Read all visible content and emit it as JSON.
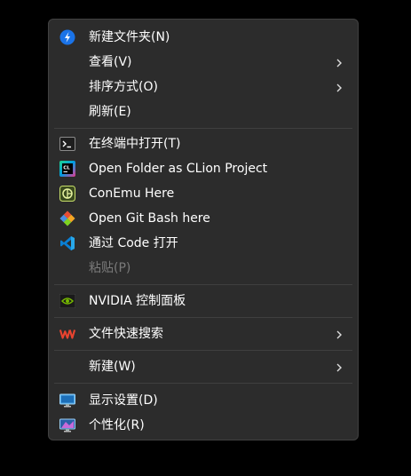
{
  "menu": {
    "items": [
      {
        "label": "新建文件夹(N)",
        "icon": "new-folder-icon"
      },
      {
        "label": "查看(V)",
        "submenu": true
      },
      {
        "label": "排序方式(O)",
        "submenu": true
      },
      {
        "label": "刷新(E)"
      },
      {
        "label": "在终端中打开(T)",
        "icon": "terminal-icon"
      },
      {
        "label": "Open Folder as CLion Project",
        "icon": "clion-icon"
      },
      {
        "label": "ConEmu Here",
        "icon": "conemu-icon"
      },
      {
        "label": "Open Git Bash here",
        "icon": "git-icon"
      },
      {
        "label": "通过 Code 打开",
        "icon": "vscode-icon"
      },
      {
        "label": "粘贴(P)",
        "disabled": true
      },
      {
        "label": "NVIDIA 控制面板",
        "icon": "nvidia-icon"
      },
      {
        "label": "文件快速搜索",
        "icon": "wps-icon",
        "submenu": true
      },
      {
        "label": "新建(W)",
        "submenu": true
      },
      {
        "label": "显示设置(D)",
        "icon": "display-icon"
      },
      {
        "label": "个性化(R)",
        "icon": "personalize-icon"
      }
    ]
  }
}
